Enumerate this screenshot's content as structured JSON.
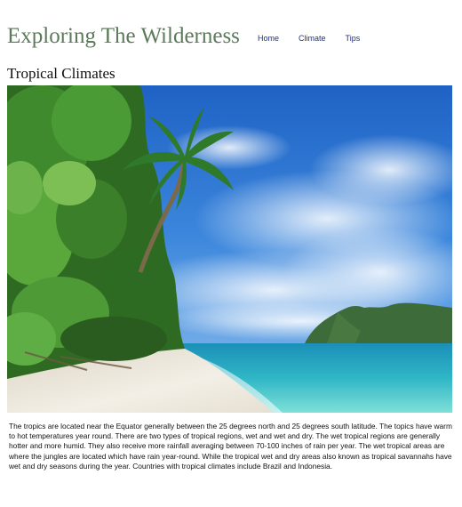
{
  "header": {
    "site_title": "Exploring The Wilderness",
    "nav": [
      {
        "label": "Home"
      },
      {
        "label": "Climate"
      },
      {
        "label": "Tips"
      }
    ]
  },
  "main": {
    "heading": "Tropical Climates",
    "image": {
      "alt": "Tropical Climates"
    },
    "paragraph": "The tropics are located near the Equator generally between the 25 degrees north and 25 degrees south latitude. The topics have warm to hot temperatures year round. There are two types of tropical regions, wet and wet and dry. The wet tropical regions are generally hotter and more humid. They also receive more rainfall averaging between 70-100 inches of rain per year. The wet tropical areas are where the jungles are located which have rain year-round. While the tropical wet and dry areas also known as tropical savannahs have wet and dry seasons during the year. Countries with tropical climates include Brazil and Indonesia."
  },
  "colors": {
    "title": "#5a7a5a",
    "nav_link": "#1f2f8a",
    "sky": "#2a7fd6",
    "sea": "#3ec6c9",
    "sand": "#eeeadf",
    "foliage": "#3c7a2a"
  }
}
